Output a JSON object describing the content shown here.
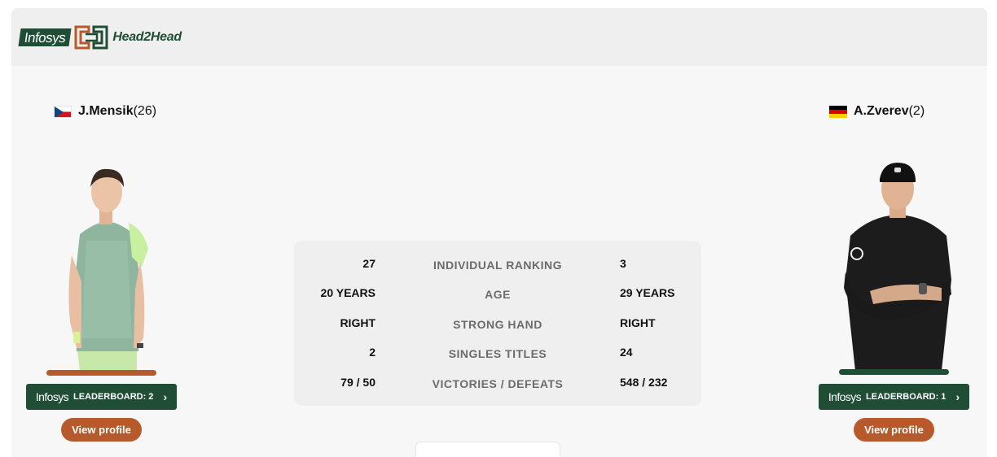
{
  "header": {
    "brand": "Infosys",
    "product": "Head2Head"
  },
  "players": {
    "left": {
      "name": "J.Mensik",
      "seed": "(26)",
      "flag": "czech-flag-icon",
      "leaderboard_brand": "Infosys",
      "leaderboard_label": "LEADERBOARD: 2",
      "profile_label": "View profile",
      "stand_color": "#b8592b"
    },
    "right": {
      "name": "A.Zverev",
      "seed": "(2)",
      "flag": "german-flag-icon",
      "leaderboard_brand": "Infosys",
      "leaderboard_label": "LEADERBOARD: 1",
      "profile_label": "View profile",
      "stand_color": "#1f4d36"
    }
  },
  "stats": [
    {
      "left": "27",
      "label": "INDIVIDUAL RANKING",
      "right": "3"
    },
    {
      "left": "20 YEARS",
      "label": "AGE",
      "right": "29 YEARS"
    },
    {
      "left": "RIGHT",
      "label": "STRONG HAND",
      "right": "RIGHT"
    },
    {
      "left": "2",
      "label": "SINGLES TITLES",
      "right": "24"
    },
    {
      "left": "79 / 50",
      "label": "VICTORIES / DEFEATS",
      "right": "548 / 232"
    }
  ],
  "colors": {
    "brand_green": "#1f4d36",
    "clay_orange": "#b8592b"
  }
}
